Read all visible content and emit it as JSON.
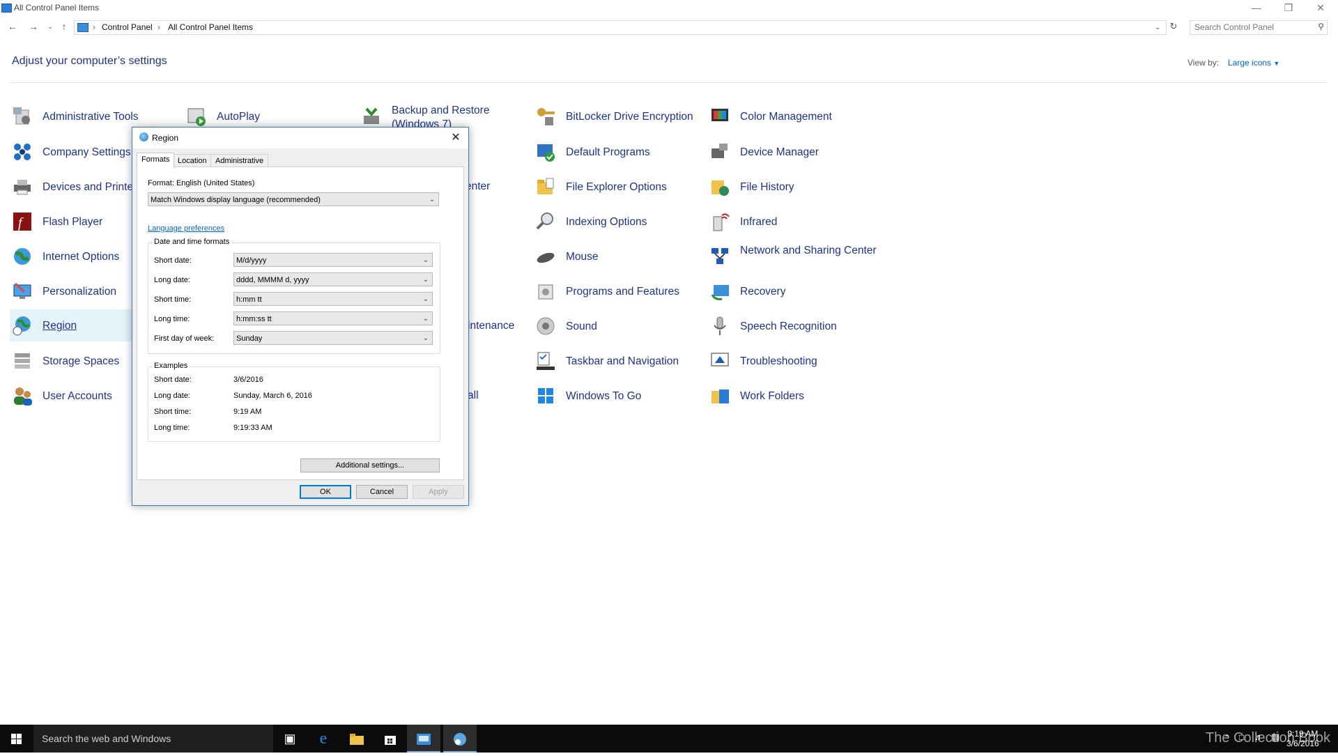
{
  "window": {
    "title": "All Control Panel Items"
  },
  "address": {
    "crumbs": [
      "Control Panel",
      "All Control Panel Items"
    ],
    "search_placeholder": "Search Control Panel"
  },
  "header": {
    "title": "Adjust your computer’s settings",
    "view_by_label": "View by:",
    "view_by_value": "Large icons"
  },
  "items": {
    "col1": [
      "Administrative Tools",
      "Company Settings",
      "Devices and Printe",
      "Flash Player",
      "Internet Options",
      "Personalization",
      "Region",
      "Storage Spaces",
      "User Accounts"
    ],
    "col2_top": "AutoPlay",
    "col3_top": "Backup and Restore (Windows 7)",
    "col3_partial": [
      "enter",
      "intenance",
      "all"
    ],
    "col4": [
      "BitLocker Drive Encryption",
      "Default Programs",
      "File Explorer Options",
      "Indexing Options",
      "Mouse",
      "Programs and Features",
      "Sound",
      "Taskbar and Navigation",
      "Windows To Go"
    ],
    "col5": [
      "Color Management",
      "Device Manager",
      "File History",
      "Infrared",
      "Network and Sharing Center",
      "Recovery",
      "Speech Recognition",
      "Troubleshooting",
      "Work Folders"
    ]
  },
  "dialog": {
    "title": "Region",
    "tabs": [
      "Formats",
      "Location",
      "Administrative"
    ],
    "format_label": "Format: English (United States)",
    "format_value": "Match Windows display language (recommended)",
    "language_link": "Language preferences",
    "dt_group": "Date and time formats",
    "fields": [
      {
        "label": "Short date:",
        "value": "M/d/yyyy"
      },
      {
        "label": "Long date:",
        "value": "dddd, MMMM d, yyyy"
      },
      {
        "label": "Short time:",
        "value": "h:mm tt"
      },
      {
        "label": "Long time:",
        "value": "h:mm:ss tt"
      },
      {
        "label": "First day of week:",
        "value": "Sunday"
      }
    ],
    "examples_group": "Examples",
    "examples": [
      {
        "label": "Short date:",
        "value": "3/6/2016"
      },
      {
        "label": "Long date:",
        "value": "Sunday, March 6, 2016"
      },
      {
        "label": "Short time:",
        "value": "9:19 AM"
      },
      {
        "label": "Long time:",
        "value": "9:19:33 AM"
      }
    ],
    "additional_button": "Additional settings...",
    "ok": "OK",
    "cancel": "Cancel",
    "apply": "Apply"
  },
  "taskbar": {
    "search_placeholder": "Search the web and Windows",
    "time": "9:19 AM",
    "date": "3/6/2016",
    "watermark": "The Collection Book"
  }
}
